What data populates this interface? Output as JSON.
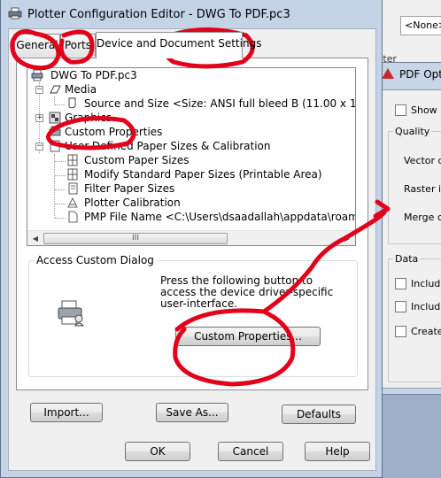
{
  "background": {
    "close_glyph": "✕",
    "none_dropdown": "<None>",
    "partial_label": "tter"
  },
  "pdf_options": {
    "title": "PDF Opti",
    "show_label": "Show",
    "quality_group": "Quality",
    "vector_quality": "Vector qu",
    "raster_quality": "Raster im",
    "merge_control": "Merge co",
    "data_group": "Data",
    "include_1": "Includ",
    "include_2": "Includ",
    "create": "Create"
  },
  "dialog": {
    "title": "Plotter Configuration Editor - DWG To PDF.pc3",
    "tabs": [
      {
        "label": "General"
      },
      {
        "label": "Ports"
      },
      {
        "label": "Device and Document Settings"
      }
    ],
    "active_tab": 2,
    "tree": {
      "root": "DWG To PDF.pc3",
      "media": "Media",
      "source_size": "Source and Size <Size: ANSI full bleed B (11.00 x 17.00 Inches)>",
      "graphics": "Graphics",
      "custom_properties": "Custom Properties",
      "user_defined": "User-Defined Paper Sizes & Calibration",
      "custom_paper_sizes": "Custom Paper Sizes",
      "modify_standard": "Modify Standard Paper Sizes (Printable Area)",
      "filter_paper_sizes": "Filter Paper Sizes",
      "plotter_calibration": "Plotter Calibration",
      "pmp_file": "PMP File Name <C:\\Users\\dsaadallah\\appdata\\roaming\\autodesk\\...>",
      "scroll_grip": "III"
    },
    "access_group": {
      "title": "Access Custom Dialog",
      "description": "Press the following button to access the device driver-specific user-interface.",
      "custom_properties_button": "Custom Properties..."
    },
    "buttons": {
      "import": "Import...",
      "save_as": "Save As...",
      "defaults": "Defaults",
      "ok": "OK",
      "cancel": "Cancel",
      "help": "Help"
    }
  },
  "colors": {
    "annotation": "#e2001a",
    "window_frame": "#c4d3e6",
    "face": "#f0f0f0"
  }
}
